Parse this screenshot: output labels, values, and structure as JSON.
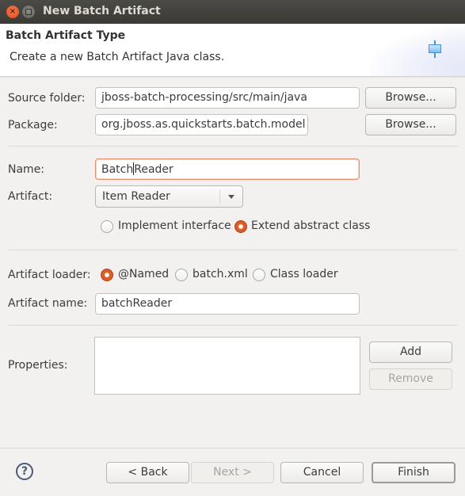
{
  "window": {
    "title": "New Batch Artifact",
    "close_icon": "close-icon",
    "maximize_icon": "maximize-icon"
  },
  "header": {
    "title": "Batch Artifact Type",
    "description": "Create a new Batch Artifact Java class.",
    "icon": "batch-artifact-wizard-icon"
  },
  "form": {
    "source_folder": {
      "label": "Source folder:",
      "value": "jboss-batch-processing/src/main/java",
      "browse_label": "Browse..."
    },
    "package": {
      "label": "Package:",
      "value": "org.jboss.as.quickstarts.batch.model",
      "browse_label": "Browse..."
    },
    "name": {
      "label": "Name:",
      "value_before_caret": "Batch",
      "value_after_caret": "Reader"
    },
    "artifact": {
      "label": "Artifact:",
      "selected": "Item Reader"
    },
    "implementation": {
      "options": [
        {
          "label": "Implement interface",
          "checked": false
        },
        {
          "label": "Extend abstract class",
          "checked": true
        }
      ]
    },
    "artifact_loader": {
      "label": "Artifact loader:",
      "options": [
        {
          "label": "@Named",
          "checked": true
        },
        {
          "label": "batch.xml",
          "checked": false
        },
        {
          "label": "Class loader",
          "checked": false
        }
      ]
    },
    "artifact_name": {
      "label": "Artifact name:",
      "value": "batchReader"
    },
    "properties": {
      "label": "Properties:",
      "add_label": "Add",
      "remove_label": "Remove",
      "rows": []
    }
  },
  "footer": {
    "help_icon": "help-icon",
    "back_label": "< Back",
    "next_label": "Next >",
    "cancel_label": "Cancel",
    "finish_label": "Finish"
  },
  "colors": {
    "accent": "#df4b16",
    "titlebar": "#3c3b37",
    "background": "#f2f1ef"
  }
}
